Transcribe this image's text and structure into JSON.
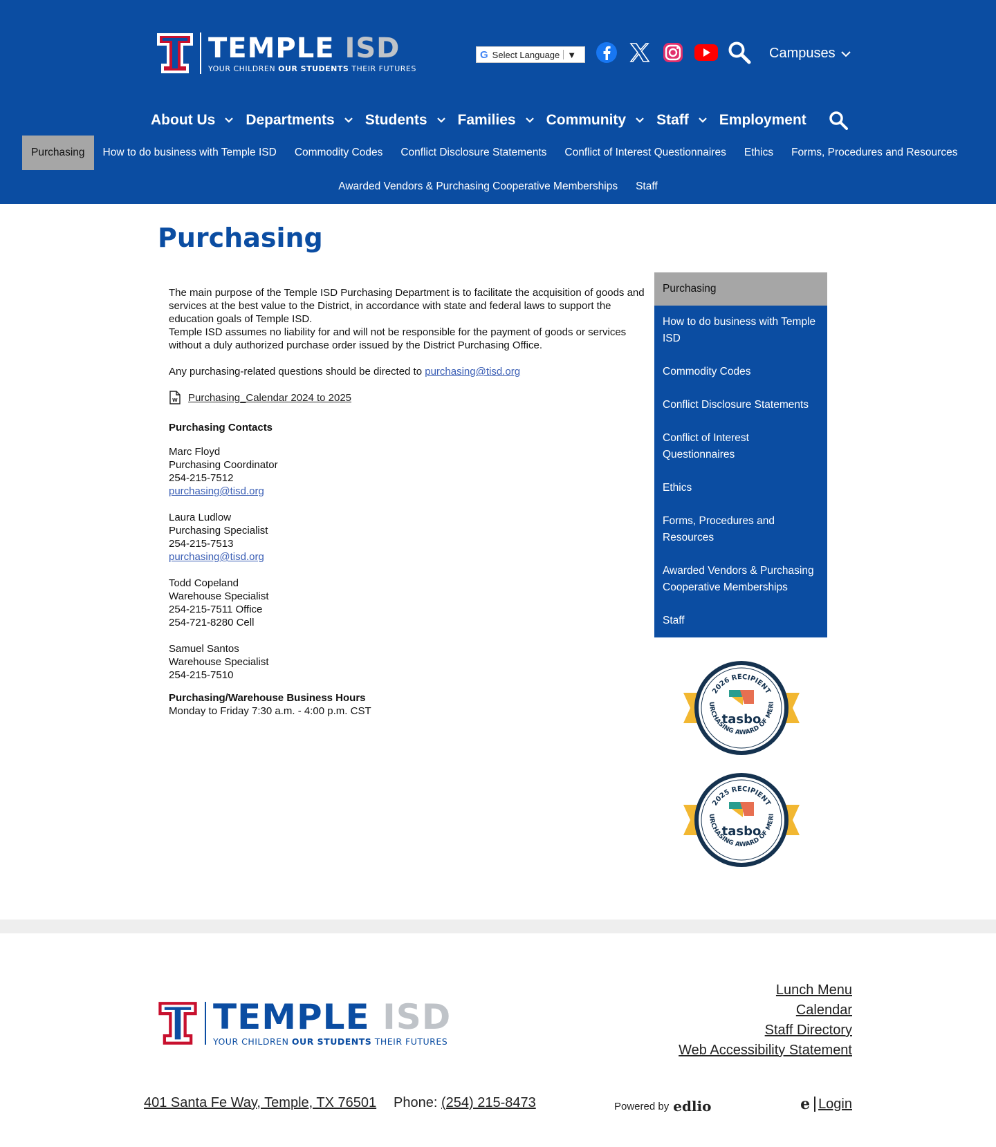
{
  "header": {
    "logo_main": "TEMPLE",
    "logo_isd": "ISD",
    "logo_tag_1": "YOUR CHILDREN",
    "logo_tag_2": "OUR STUDENTS",
    "logo_tag_3": "THEIR FUTURES",
    "language_select": "Select Language",
    "campuses": "Campuses",
    "social": [
      "facebook-icon",
      "x-twitter-icon",
      "instagram-icon",
      "youtube-icon",
      "search-icon"
    ]
  },
  "main_nav": [
    {
      "label": "About Us"
    },
    {
      "label": "Departments"
    },
    {
      "label": "Students"
    },
    {
      "label": "Families"
    },
    {
      "label": "Community"
    },
    {
      "label": "Staff"
    },
    {
      "label": "Employment"
    }
  ],
  "sub_nav": [
    "Purchasing",
    "How to do business with Temple ISD",
    "Commodity Codes",
    "Conflict Disclosure Statements",
    "Conflict of Interest Questionnaires",
    "Ethics",
    "Forms, Procedures and Resources",
    "Awarded Vendors & Purchasing Cooperative Memberships",
    "Staff"
  ],
  "page": {
    "title": "Purchasing",
    "intro_1": "The main purpose of the Temple ISD Purchasing Department is to facilitate the acquisition of goods and services at the best value to the District, in accordance with state and federal laws to support the education goals of Temple ISD.",
    "intro_2": "Temple ISD assumes no liability for and will not be responsible for the payment of goods or services without a duly authorized purchase order issued by the District Purchasing Office.",
    "questions_text": "Any purchasing-related questions should be directed to ",
    "questions_email": "purchasing@tisd.org",
    "file_link": "Purchasing_Calendar 2024 to 2025",
    "contacts_heading": "Purchasing Contacts",
    "contacts": [
      {
        "name": "Marc Floyd",
        "title": "Purchasing Coordinator",
        "phone": "254-215-7512",
        "email": "purchasing@tisd.org"
      },
      {
        "name": "Laura Ludlow",
        "title": "Purchasing Specialist",
        "phone": "254-215-7513",
        "email": "purchasing@tisd.org"
      },
      {
        "name": "Todd Copeland",
        "title": "Warehouse Specialist",
        "phone": "254-215-7511 Office",
        "phone2": "254-721-8280 Cell"
      },
      {
        "name": "Samuel Santos",
        "title": "Warehouse Specialist",
        "phone": "254-215-7510"
      }
    ],
    "hours_heading": "Purchasing/Warehouse Business Hours",
    "hours": "Monday to Friday 7:30 a.m. - 4:00 p.m. CST"
  },
  "sidebar": [
    "Purchasing",
    "How to do business with Temple ISD",
    "Commodity Codes",
    "Conflict Disclosure Statements",
    "Conflict of Interest Questionnaires",
    "Ethics",
    "Forms, Procedures and Resources",
    "Awarded Vendors & Purchasing Cooperative Memberships",
    "Staff"
  ],
  "badges": [
    {
      "year": "2026 RECIPIENT",
      "brand": "tasbo",
      "award": "PURCHASING AWARD OF MERIT"
    },
    {
      "year": "2025 RECIPIENT",
      "brand": "tasbo",
      "award": "PURCHASING AWARD OF MERIT"
    }
  ],
  "footer": {
    "links": [
      "Lunch Menu",
      "Calendar",
      "Staff Directory",
      "Web Accessibility Statement"
    ],
    "address": "401 Santa Fe Way, Temple, TX 76501",
    "phone_label": "Phone: ",
    "phone": "(254) 215-8473",
    "powered_by": "Powered by",
    "edlio": "edlio",
    "login": "Login"
  },
  "colors": {
    "brand_blue": "#0b4da2",
    "active_gray": "#a6a6a6",
    "link_blue": "#3b5fb5",
    "badge_gold": "#f2b731",
    "badge_navy": "#15324f"
  }
}
